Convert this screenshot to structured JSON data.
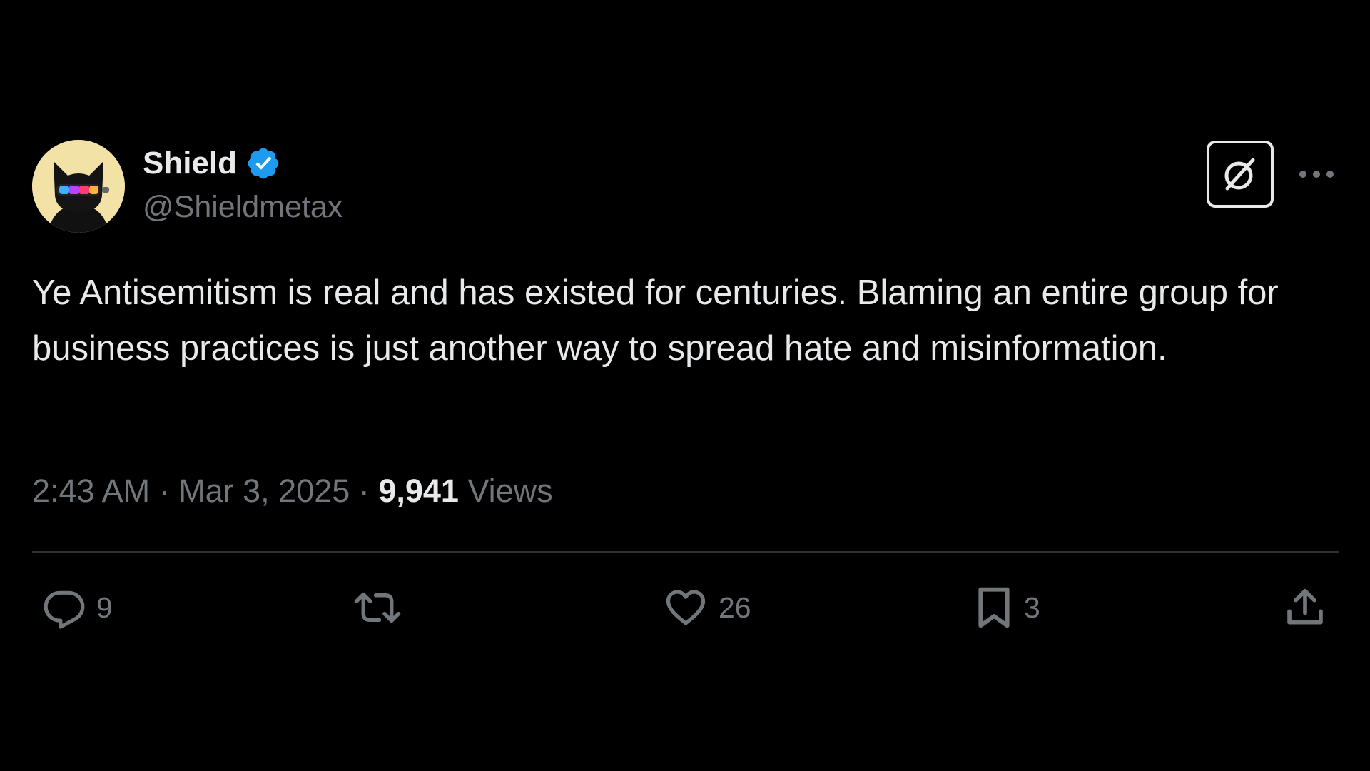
{
  "tweet": {
    "author": {
      "display_name": "Shield",
      "handle": "@Shieldmetax",
      "verified": true,
      "verified_color": "#1d9bf0",
      "avatar_icon": "black-cat-with-colorful-visor-avatar"
    },
    "text": "Ye Antisemitism is real and has existed for centuries. Blaming an entire group for business practices is just another way to spread hate and misinformation.",
    "time": "2:43 AM",
    "date": "Mar 3, 2025",
    "separator": "·",
    "views_count": "9,941",
    "views_label": "Views",
    "actions": {
      "reply": {
        "icon": "reply-icon",
        "count": "9"
      },
      "repost": {
        "icon": "repost-icon",
        "count": ""
      },
      "like": {
        "icon": "heart-icon",
        "count": "26"
      },
      "bookmark": {
        "icon": "bookmark-icon",
        "count": "3"
      },
      "share": {
        "icon": "share-icon",
        "count": ""
      }
    },
    "header_buttons": {
      "grok": "grok-icon",
      "more": "more-icon"
    }
  },
  "colors": {
    "background": "#000000",
    "primary_text": "#e7e9ea",
    "secondary_text": "#71767b",
    "divider": "#2f3336"
  }
}
